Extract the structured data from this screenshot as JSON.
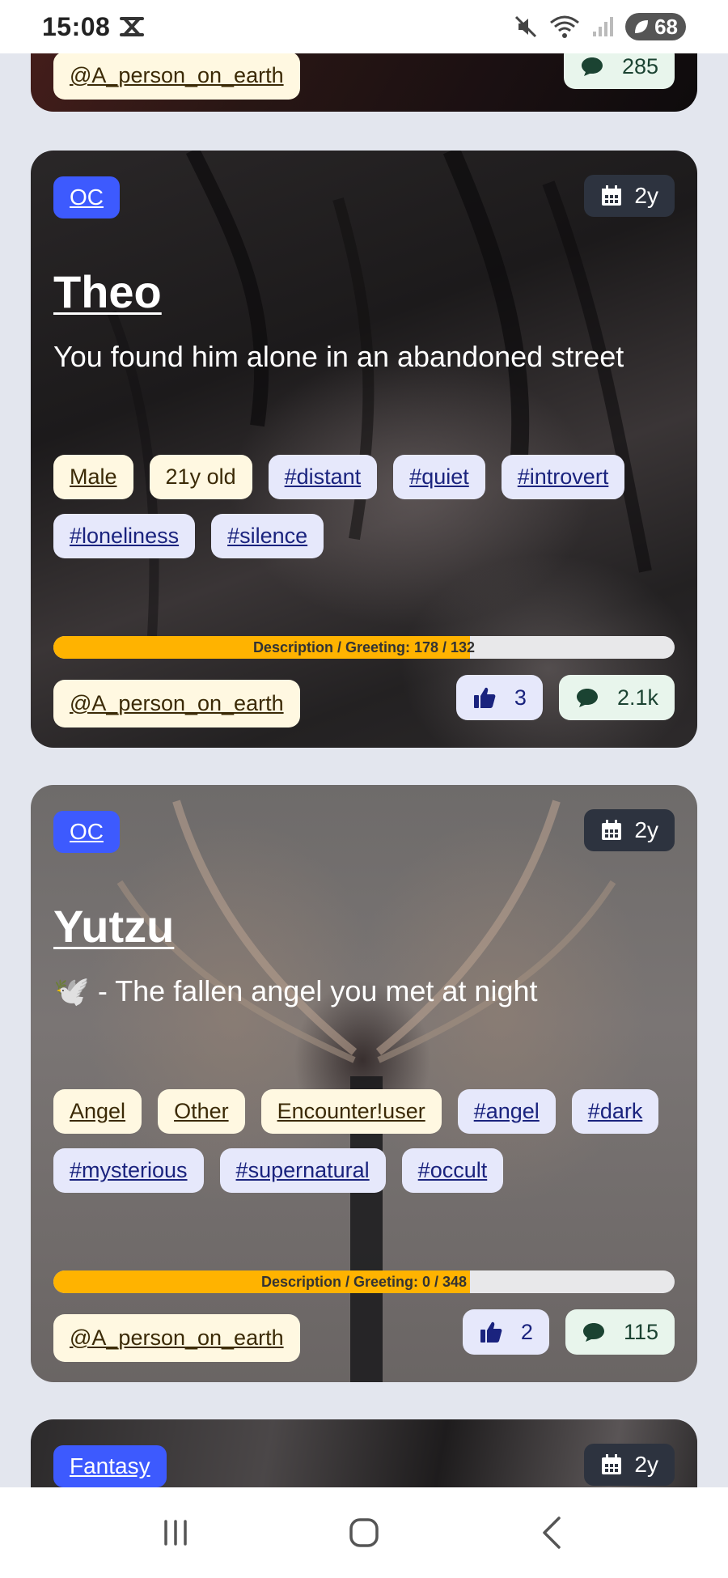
{
  "status_bar": {
    "time": "15:08",
    "battery": "68",
    "icons": [
      "notification-x-icon",
      "mute-icon",
      "wifi-icon",
      "signal-icon",
      "leaf-icon"
    ]
  },
  "cards": [
    {
      "author": "@A_person_on_earth",
      "comments": "285"
    },
    {
      "category": "OC",
      "age": "2y",
      "name": "Theo",
      "description": "You found him alone in an abandoned street",
      "tags": [
        {
          "label": "Male",
          "kind": "attribute"
        },
        {
          "label": "21y old",
          "kind": "attribute"
        },
        {
          "label": "#distant",
          "kind": "hashtag"
        },
        {
          "label": "#quiet",
          "kind": "hashtag"
        },
        {
          "label": "#introvert",
          "kind": "hashtag"
        },
        {
          "label": "#loneliness",
          "kind": "hashtag"
        },
        {
          "label": "#silence",
          "kind": "hashtag"
        }
      ],
      "progress_label": "Description / Greeting: 178 / 132",
      "progress_fraction": 0.67,
      "author": "@A_person_on_earth",
      "likes": "3",
      "comments": "2.1k"
    },
    {
      "category": "OC",
      "age": "2y",
      "name": "Yutzu",
      "description": "🕊️ - The fallen angel you met at night",
      "tags": [
        {
          "label": "Angel",
          "kind": "attribute"
        },
        {
          "label": "Other",
          "kind": "attribute"
        },
        {
          "label": "Encounter!user",
          "kind": "attribute"
        },
        {
          "label": "#angel",
          "kind": "hashtag"
        },
        {
          "label": "#dark",
          "kind": "hashtag"
        },
        {
          "label": "#mysterious",
          "kind": "hashtag"
        },
        {
          "label": "#supernatural",
          "kind": "hashtag"
        },
        {
          "label": "#occult",
          "kind": "hashtag"
        }
      ],
      "progress_label": "Description / Greeting: 0 / 348",
      "progress_fraction": 0.67,
      "author": "@A_person_on_earth",
      "likes": "2",
      "comments": "115"
    },
    {
      "category": "Fantasy",
      "age": "2y"
    }
  ],
  "nav_bar": {
    "icons": [
      "recent-apps-icon",
      "home-icon",
      "back-icon"
    ]
  }
}
